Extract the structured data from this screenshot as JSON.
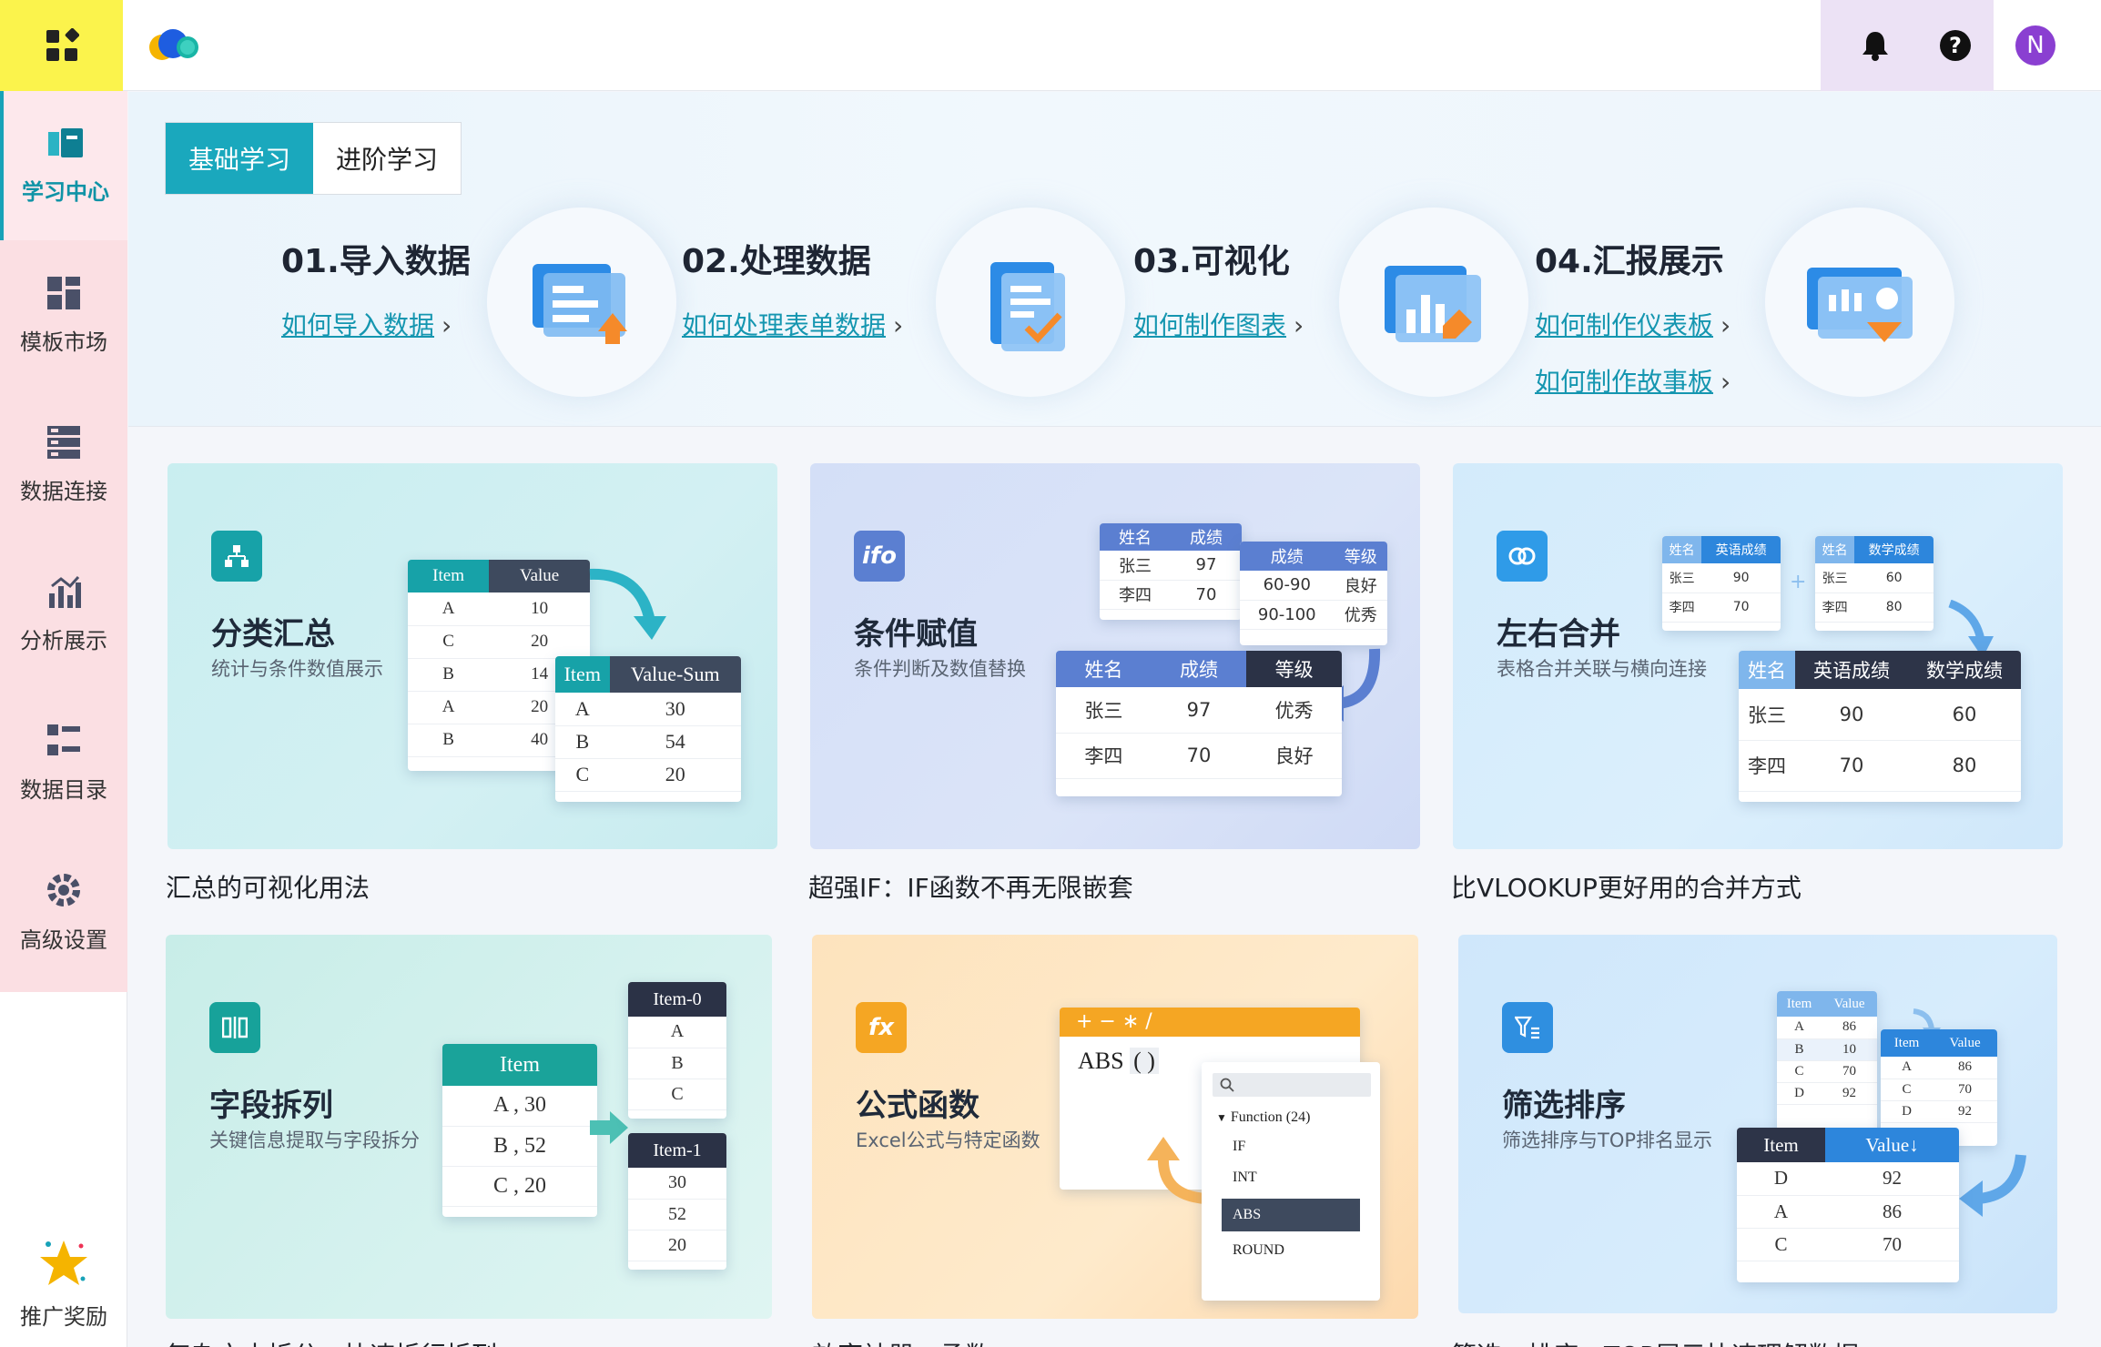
{
  "header": {
    "apps_icon": "apps-grid-icon",
    "logo_icon": "cloud-logo-icon",
    "bell_icon": "bell-icon",
    "help_icon": "help-icon",
    "avatar_letter": "N"
  },
  "sidebar": {
    "items": [
      {
        "label": "学习中心",
        "icon": "book-icon",
        "active": true
      },
      {
        "label": "模板市场",
        "icon": "template-icon"
      },
      {
        "label": "数据连接",
        "icon": "data-link-icon"
      },
      {
        "label": "分析展示",
        "icon": "chart-icon"
      },
      {
        "label": "数据目录",
        "icon": "catalog-icon"
      },
      {
        "label": "高级设置",
        "icon": "gear-icon"
      }
    ],
    "bottom": {
      "label": "推广奖励",
      "icon": "star-icon"
    }
  },
  "hero": {
    "tabs": [
      "基础学习",
      "进阶学习"
    ],
    "steps": [
      {
        "title": "01.导入数据",
        "links": [
          "如何导入数据"
        ]
      },
      {
        "title": "02.处理数据",
        "links": [
          "如何处理表单数据"
        ]
      },
      {
        "title": "03.可视化",
        "links": [
          "如何制作图表"
        ]
      },
      {
        "title": "04.汇报展示",
        "links": [
          "如何制作仪表板",
          "如何制作故事板"
        ]
      }
    ],
    "arrow": "›"
  },
  "cards": [
    {
      "title": "分类汇总",
      "sub": "统计与条件数值展示",
      "caption": "汇总的可视化用法",
      "color": "#17a2a8",
      "table1": {
        "headers": [
          "Item",
          "Value"
        ],
        "rows": [
          [
            "A",
            "10"
          ],
          [
            "C",
            "20"
          ],
          [
            "B",
            "14"
          ],
          [
            "A",
            "20"
          ],
          [
            "B",
            "40"
          ]
        ]
      },
      "table2": {
        "headers": [
          "Item",
          "Value-Sum"
        ],
        "rows": [
          [
            "A",
            "30"
          ],
          [
            "B",
            "54"
          ],
          [
            "C",
            "20"
          ]
        ]
      }
    },
    {
      "title": "条件赋值",
      "sub": "条件判断及数值替换",
      "caption": "超强IF：IF函数不再无限嵌套",
      "color": "#5b7fd1",
      "icon_text": "ifo",
      "table1": {
        "headers": [
          "姓名",
          "成绩"
        ],
        "rows": [
          [
            "张三",
            "97"
          ],
          [
            "李四",
            "70"
          ]
        ]
      },
      "table2": {
        "headers": [
          "成绩",
          "等级"
        ],
        "rows": [
          [
            "60-90",
            "良好"
          ],
          [
            "90-100",
            "优秀"
          ]
        ]
      },
      "table3": {
        "headers": [
          "姓名",
          "成绩",
          "等级"
        ],
        "rows": [
          [
            "张三",
            "97",
            "优秀"
          ],
          [
            "李四",
            "70",
            "良好"
          ]
        ]
      }
    },
    {
      "title": "左右合并",
      "sub": "表格合并关联与横向连接",
      "caption": "比VLOOKUP更好用的合并方式",
      "color": "#2f9be8",
      "table1": {
        "headers": [
          "姓名",
          "英语成绩"
        ],
        "rows": [
          [
            "张三",
            "90"
          ],
          [
            "李四",
            "70"
          ]
        ]
      },
      "plus": "+",
      "table2": {
        "headers": [
          "姓名",
          "数学成绩"
        ],
        "rows": [
          [
            "张三",
            "60"
          ],
          [
            "李四",
            "80"
          ]
        ]
      },
      "table3": {
        "headers": [
          "姓名",
          "英语成绩",
          "数学成绩"
        ],
        "rows": [
          [
            "张三",
            "90",
            "60"
          ],
          [
            "李四",
            "70",
            "80"
          ]
        ]
      }
    },
    {
      "title": "字段拆列",
      "sub": "关键信息提取与字段拆分",
      "caption": "复杂文本拆分，快速拆行拆列",
      "color": "#17a2a8",
      "table1": {
        "headers": [
          "Item"
        ],
        "rows": [
          [
            "A , 30"
          ],
          [
            "B , 52"
          ],
          [
            "C , 20"
          ]
        ]
      },
      "table2": {
        "headers": [
          "Item-0"
        ],
        "rows": [
          [
            "A"
          ],
          [
            "B"
          ],
          [
            "C"
          ]
        ]
      },
      "table3": {
        "headers": [
          "Item-1"
        ],
        "rows": [
          [
            "30"
          ],
          [
            "52"
          ],
          [
            "20"
          ]
        ]
      }
    },
    {
      "title": "公式函数",
      "sub": "Excel公式与特定函数",
      "caption": "效率神器：函数",
      "color": "#f5a623",
      "icon_text": "fx",
      "ops": "+ − ∗ /",
      "formula": "ABS",
      "formula_arg": "( )",
      "function_group": "Function (24)",
      "functions": [
        "IF",
        "INT",
        "ABS",
        "ROUND"
      ],
      "selected_function": "ABS"
    },
    {
      "title": "筛选排序",
      "sub": "筛选排序与TOP排名显示",
      "caption": "筛选、排序，TOP展示快速理解数据",
      "color": "#2f8fe0",
      "table1": {
        "headers": [
          "Item",
          "Value"
        ],
        "rows": [
          [
            "A",
            "86"
          ],
          [
            "B",
            "10"
          ],
          [
            "C",
            "70"
          ],
          [
            "D",
            "92"
          ]
        ]
      },
      "table2": {
        "headers": [
          "Item",
          "Value"
        ],
        "rows": [
          [
            "A",
            "86"
          ],
          [
            "C",
            "70"
          ],
          [
            "D",
            "92"
          ]
        ]
      },
      "table3": {
        "headers": [
          "Item",
          "Value↓"
        ],
        "rows": [
          [
            "D",
            "92"
          ],
          [
            "A",
            "86"
          ],
          [
            "C",
            "70"
          ]
        ]
      }
    }
  ]
}
